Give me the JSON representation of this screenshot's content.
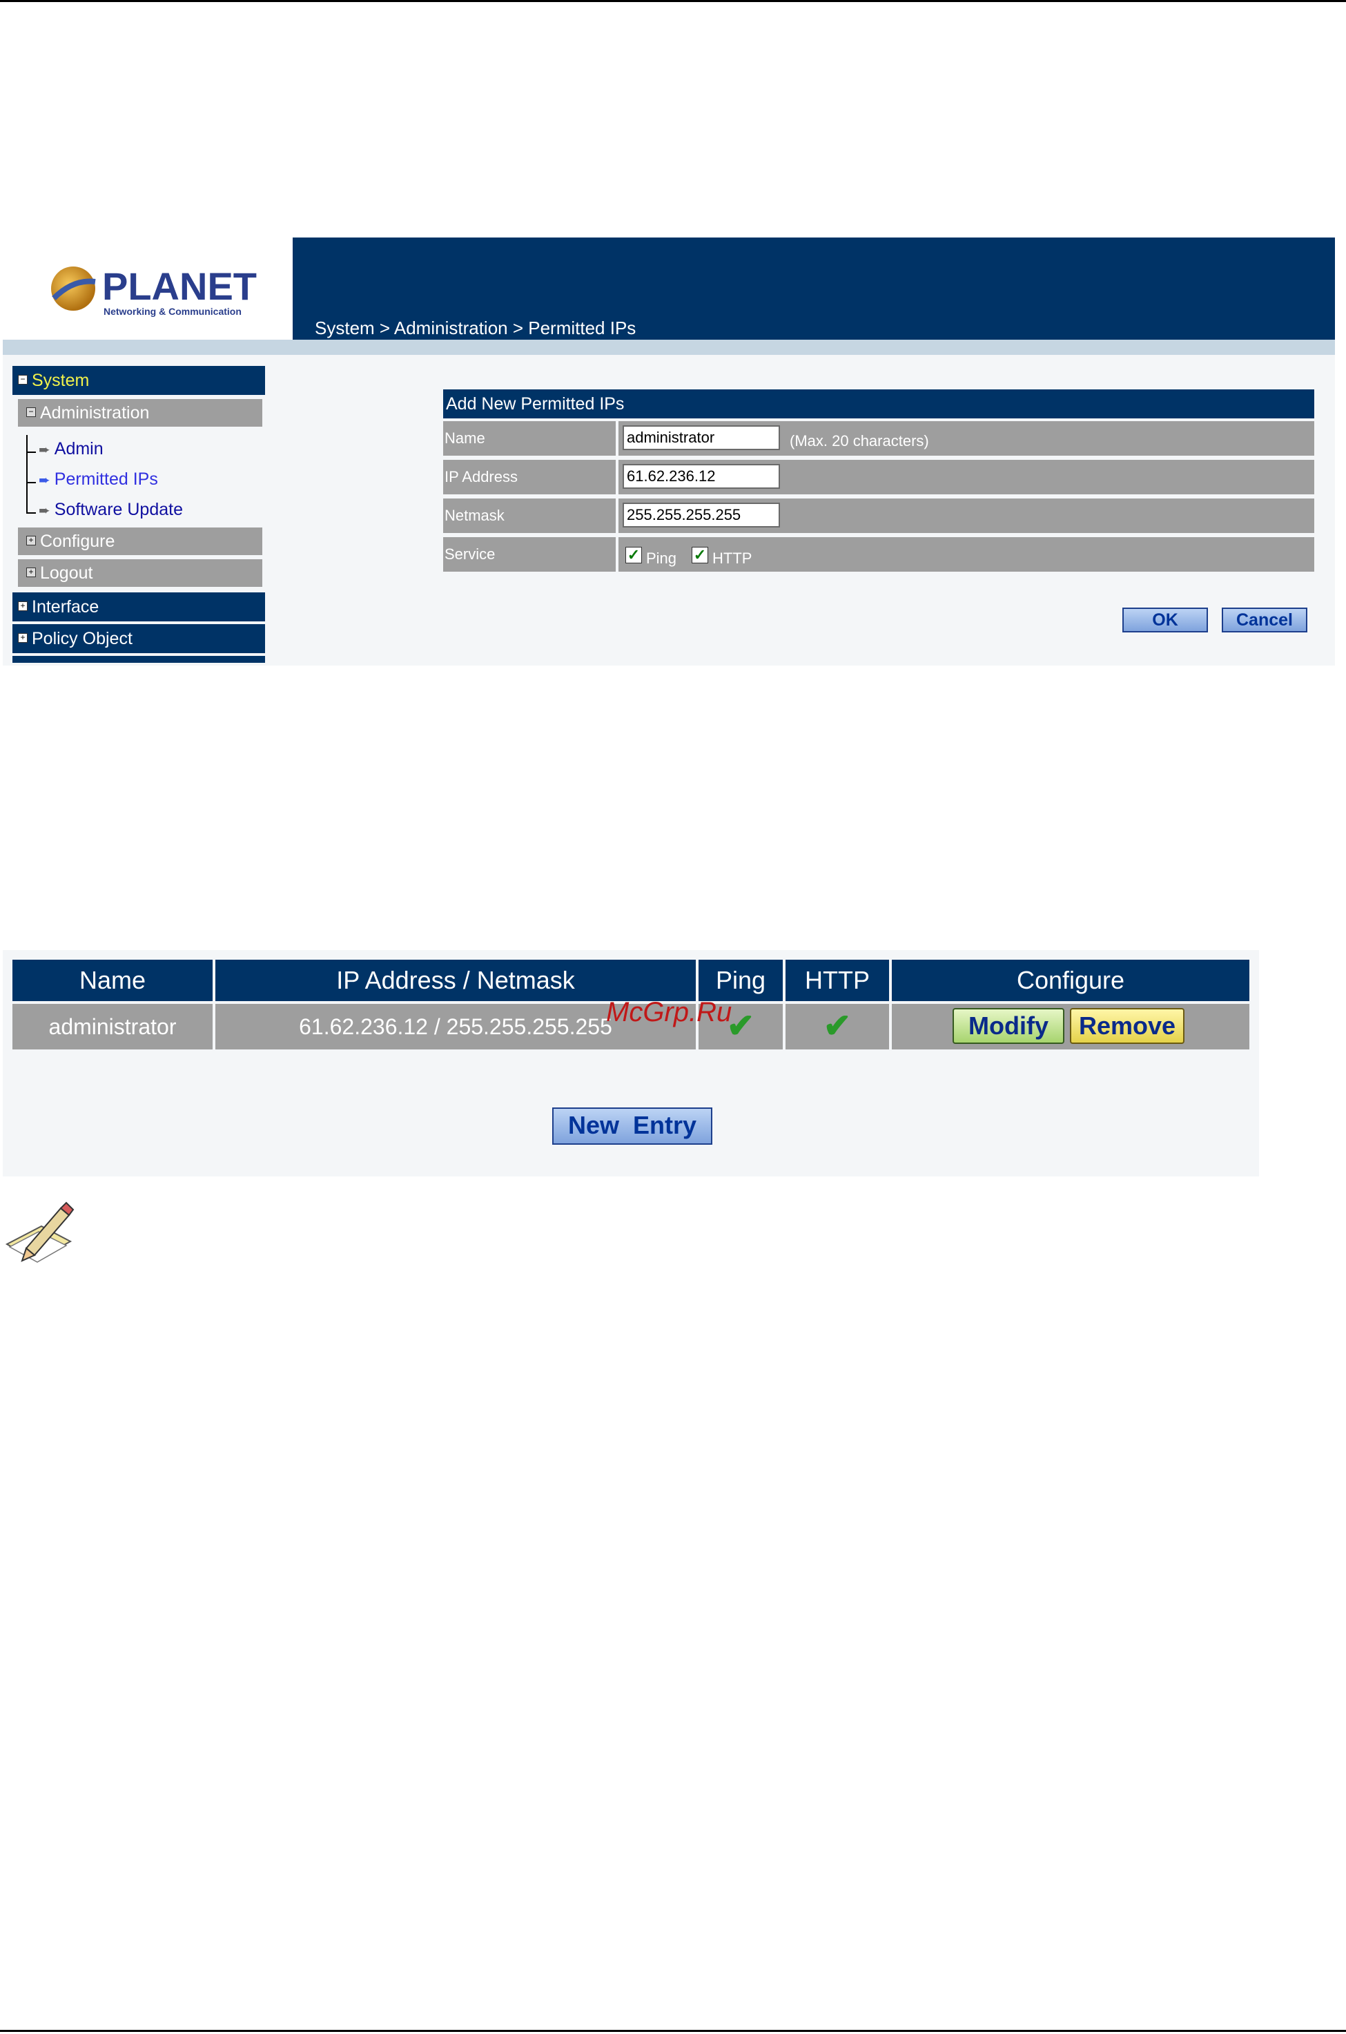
{
  "header": {
    "logo_text": "PLANET",
    "logo_tagline": "Networking & Communication",
    "breadcrumb": "System > Administration > Permitted IPs"
  },
  "sidebar": {
    "system": "System",
    "administration": "Administration",
    "admin": "Admin",
    "permitted_ips": "Permitted IPs",
    "software_update": "Software Update",
    "configure": "Configure",
    "logout": "Logout",
    "interface": "Interface",
    "policy_object": "Policy Object",
    "expanded_icon": "−",
    "collapsed_icon": "+",
    "arrow_icon": "➨"
  },
  "form": {
    "title": "Add New Permitted IPs",
    "name_label": "Name",
    "name_value": "administrator",
    "name_hint": "(Max. 20 characters)",
    "ip_label": "IP Address",
    "ip_value": "61.62.236.12",
    "netmask_label": "Netmask",
    "netmask_value": "255.255.255.255",
    "service_label": "Service",
    "ping_label": "Ping",
    "http_label": "HTTP",
    "ping_checked": true,
    "http_checked": true,
    "check_glyph": "✓",
    "ok_label": "OK",
    "cancel_label": "Cancel"
  },
  "table": {
    "headers": {
      "name": "Name",
      "ip_netmask": "IP Address / Netmask",
      "ping": "Ping",
      "http": "HTTP",
      "configure": "Configure"
    },
    "rows": [
      {
        "name": "administrator",
        "ip_netmask": "61.62.236.12 / 255.255.255.255",
        "ping": true,
        "http": true
      }
    ],
    "check_glyph": "✔",
    "modify_label": "Modify",
    "remove_label": "Remove",
    "new_entry_label": "New  Entry"
  },
  "watermark": "McGrp.Ru",
  "colors": {
    "navy": "#003366",
    "gray": "#9e9e9e",
    "strip": "#c6d6e2",
    "link": "#1010a0",
    "system_text": "#f2f24a"
  }
}
